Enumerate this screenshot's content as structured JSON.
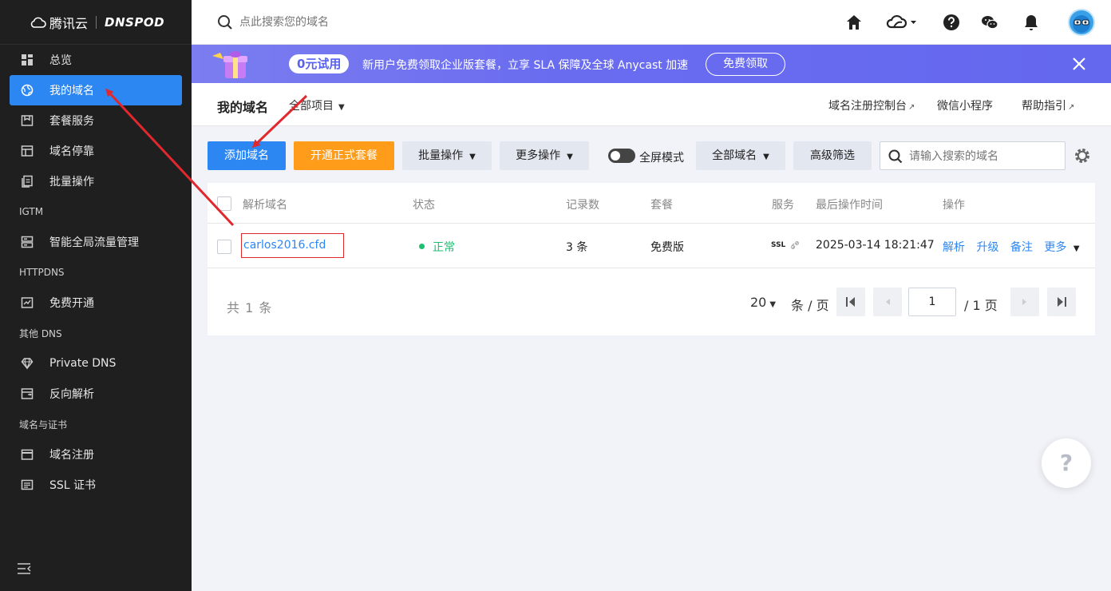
{
  "brand": {
    "name_cn": "腾讯云",
    "name_en": "DNSPOD"
  },
  "sidebar": {
    "items": [
      {
        "label": "总览",
        "icon": "dashboard-icon"
      },
      {
        "label": "我的域名",
        "icon": "globe-icon",
        "active": true
      },
      {
        "label": "套餐服务",
        "icon": "package-icon"
      },
      {
        "label": "域名停靠",
        "icon": "layout-icon"
      },
      {
        "label": "批量操作",
        "icon": "copy-icon"
      }
    ],
    "group_igtm": "IGTM",
    "igtm_items": [
      {
        "label": "智能全局流量管理",
        "icon": "server-icon"
      }
    ],
    "group_httpdns": "HTTPDNS",
    "httpdns_items": [
      {
        "label": "免费开通",
        "icon": "chart-box-icon"
      }
    ],
    "group_other": "其他 DNS",
    "other_items": [
      {
        "label": "Private DNS",
        "icon": "diamond-icon"
      },
      {
        "label": "反向解析",
        "icon": "reverse-icon"
      }
    ],
    "group_cert": "域名与证书",
    "cert_items": [
      {
        "label": "域名注册",
        "icon": "calendar-icon"
      },
      {
        "label": "SSL 证书",
        "icon": "certificate-icon"
      }
    ]
  },
  "topbar": {
    "search_placeholder": "点此搜索您的域名"
  },
  "banner": {
    "pill": "0元试用",
    "text": "新用户免费领取企业版套餐，立享 SLA 保障及全球 Anycast 加速",
    "cta": "免费领取"
  },
  "pagehead": {
    "title": "我的域名",
    "project": "全部项目",
    "links": [
      "域名注册控制台",
      "微信小程序",
      "帮助指引"
    ]
  },
  "toolbar": {
    "add_domain": "添加域名",
    "open_plan": "开通正式套餐",
    "batch": "批量操作",
    "more": "更多操作",
    "fullscreen": "全屏模式",
    "all_domains": "全部域名",
    "advanced": "高级筛选",
    "search_placeholder": "请输入搜索的域名"
  },
  "table": {
    "columns": [
      "解析域名",
      "状态",
      "记录数",
      "套餐",
      "服务",
      "最后操作时间",
      "操作"
    ],
    "rows": [
      {
        "domain": "carlos2016.cfd",
        "status": "正常",
        "records": "3 条",
        "plan": "免费版",
        "service": "SSL",
        "last_op": "2025-03-14 18:21:47",
        "actions": [
          "解析",
          "升级",
          "备注",
          "更多"
        ]
      }
    ]
  },
  "pagination": {
    "total": "共 1 条",
    "page_size": "20",
    "unit": "条 / 页",
    "current": "1",
    "pages": "/ 1 页"
  },
  "help": "?",
  "colors": {
    "primary": "#2d87f2",
    "orange": "#ff9c19",
    "sidebar_bg": "#1f1f1f",
    "banner": "#6a6cf0",
    "annotation": "#e0282e",
    "success": "#1dbf73"
  }
}
